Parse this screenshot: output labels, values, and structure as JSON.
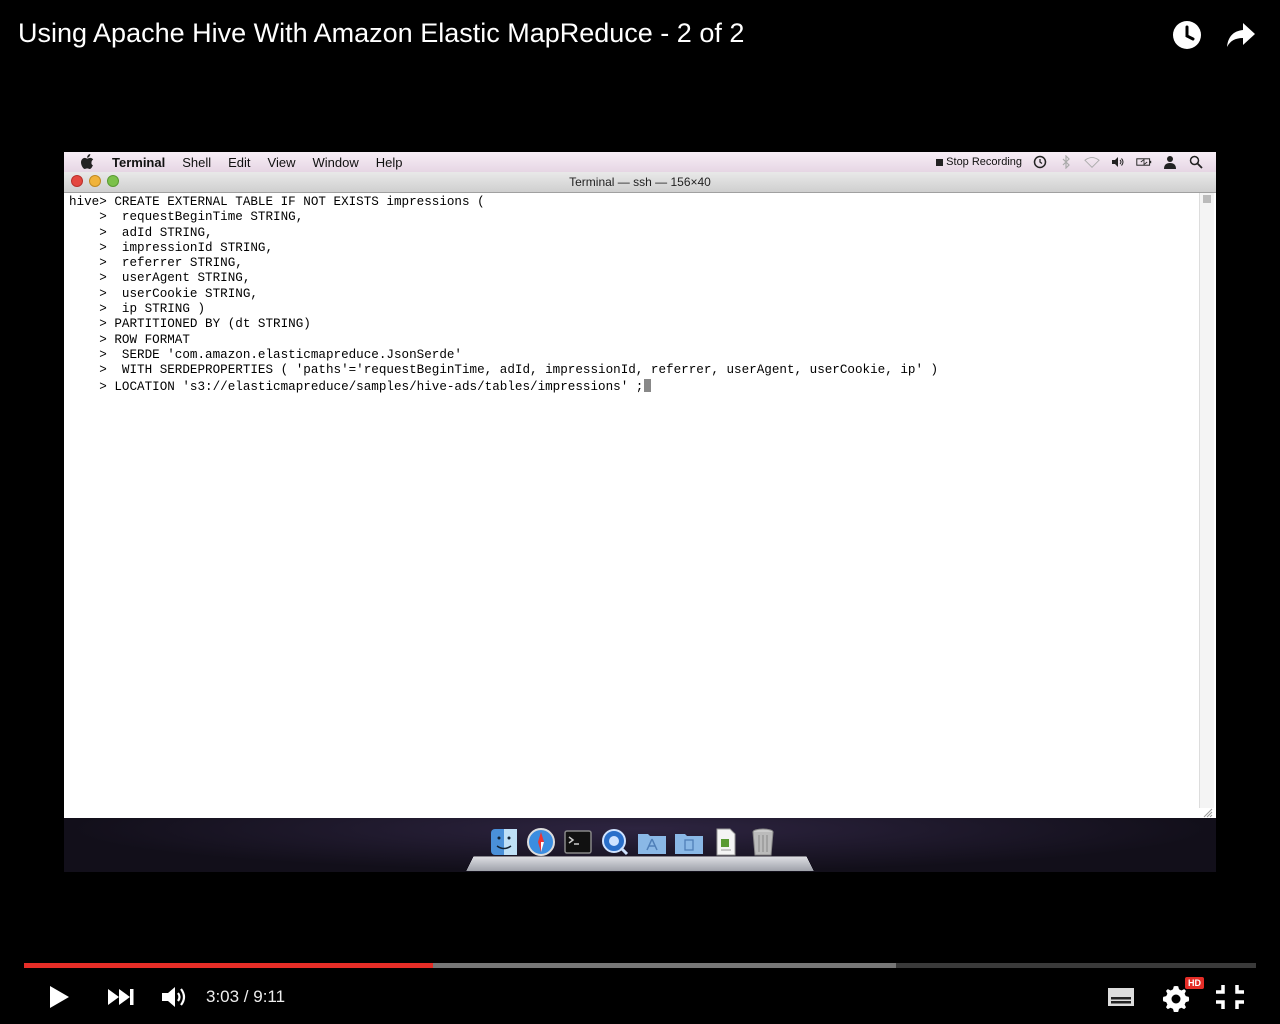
{
  "video": {
    "title": "Using Apache Hive With Amazon Elastic MapReduce - 2 of 2"
  },
  "menubar": {
    "items": [
      "Terminal",
      "Shell",
      "Edit",
      "View",
      "Window",
      "Help"
    ],
    "stop_recording": "Stop Recording"
  },
  "terminal": {
    "window_title": "Terminal — ssh — 156×40",
    "lines": [
      "hive> CREATE EXTERNAL TABLE IF NOT EXISTS impressions (",
      "    >  requestBeginTime STRING,",
      "    >  adId STRING,",
      "    >  impressionId STRING,",
      "    >  referrer STRING,",
      "    >  userAgent STRING,",
      "    >  userCookie STRING,",
      "    >  ip STRING )",
      "    > PARTITIONED BY (dt STRING)",
      "    > ROW FORMAT",
      "    >  SERDE 'com.amazon.elasticmapreduce.JsonSerde'",
      "    >  WITH SERDEPROPERTIES ( 'paths'='requestBeginTime, adId, impressionId, referrer, userAgent, userCookie, ip' )",
      "    > LOCATION 's3://elasticmapreduce/samples/hive-ads/tables/impressions' ;"
    ]
  },
  "dock": {
    "icons": [
      "finder-icon",
      "safari-icon",
      "terminal-icon",
      "quicktime-icon",
      "applications-folder-icon",
      "documents-folder-icon",
      "document-icon",
      "trash-icon"
    ]
  },
  "player": {
    "time_display": "3:03 / 9:11",
    "progress_fraction": 0.332,
    "buffered_fraction": 0.708,
    "colors": {
      "played": "#e52d27",
      "buffered": "#777777",
      "track": "#3a3a3a"
    },
    "hd_badge": "HD"
  }
}
